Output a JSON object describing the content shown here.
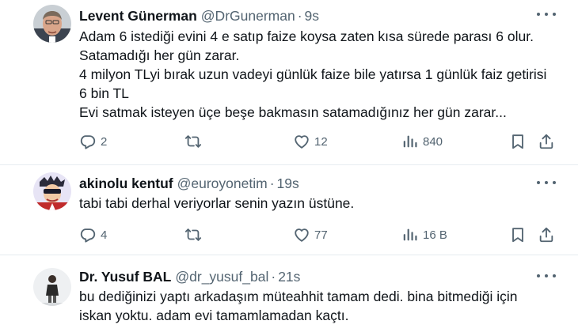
{
  "tweets": [
    {
      "author_name": "Levent Günerman",
      "handle": "@DrGunerman",
      "separator": "·",
      "time": "9s",
      "text_lines": [
        "Adam 6 istediği evini 4 e satıp faize koysa zaten kısa sürede parası 6 olur.",
        "Satamadığı her gün zarar.",
        "4 milyon TLyi bırak uzun vadeyi günlük faize bile yatırsa 1 günlük faiz getirisi",
        "6 bin TL",
        "Evi satmak isteyen üçe beşe bakmasın satamadığınız her gün zarar..."
      ],
      "replies": "2",
      "retweets": "",
      "likes": "12",
      "views": "840"
    },
    {
      "author_name": "akinolu kentuf",
      "handle": "@euroyonetim",
      "separator": "·",
      "time": "19s",
      "text_lines": [
        "tabi tabi derhal veriyorlar senin yazın üstüne."
      ],
      "replies": "4",
      "retweets": "",
      "likes": "77",
      "views": "16 B"
    },
    {
      "author_name": "Dr. Yusuf BAL",
      "handle": "@dr_yusuf_bal",
      "separator": "·",
      "time": "21s",
      "text_lines": [
        "bu dediğinizi yaptı arkadaşım müteahhit tamam dedi. bina bitmediği için",
        "iskan yoktu. adam evi tamamlamadan kaçtı."
      ]
    }
  ],
  "icons": {
    "reply": "reply-icon",
    "retweet": "retweet-icon",
    "like": "heart-icon",
    "views": "views-icon",
    "bookmark": "bookmark-icon",
    "share": "share-icon",
    "more": "more-icon"
  },
  "colors": {
    "text": "#0f1419",
    "secondary": "#536471",
    "divider": "#e6ecf0"
  }
}
